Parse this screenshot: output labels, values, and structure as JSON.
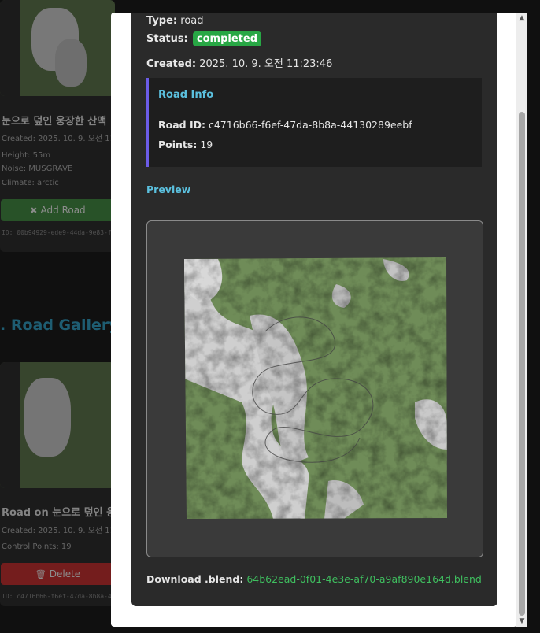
{
  "background": {
    "card1": {
      "title": "눈으로 덮인 웅장한 산맥",
      "created": "Created: 2025. 10. 9. 오전 11:",
      "height": "Height: 55m",
      "noise": "Noise: MUSGRAVE",
      "climate": "Climate: arctic",
      "button_label": "Add Road",
      "id_text": "ID: 00b94929-ede9-44da-9e83-f6c1ef6"
    },
    "section_heading": ". Road Gallery",
    "card2": {
      "title": "Road on 눈으로 덮인 웅",
      "created": "Created: 2025. 10. 9. 오전 11",
      "points": "Control Points: 19",
      "button_label": "Delete",
      "id_text": "ID: c4716b66-f6ef-47da-8b8a-44130289"
    }
  },
  "modal": {
    "type_label": "Type:",
    "type_value": "road",
    "status_label": "Status:",
    "status_value": "completed",
    "created_label": "Created:",
    "created_value": "2025. 10. 9. 오전 11:23:46",
    "road_info": {
      "title": "Road Info",
      "road_id_label": "Road ID:",
      "road_id_value": "c4716b66-f6ef-47da-8b8a-44130289eebf",
      "points_label": "Points:",
      "points_value": "19"
    },
    "preview_label": "Preview",
    "download_label": "Download .blend:",
    "download_file": "64b62ead-0f01-4e3e-af70-a9af890e164d.blend"
  },
  "colors": {
    "accent_blue": "#5bc0de",
    "status_green": "#28a745",
    "link_green": "#3fbf5f",
    "info_border": "#6c5ce7",
    "terrain_green": "#6b8a55",
    "snow": "#d0d0d0"
  },
  "icons": {
    "add_road": "road-icon",
    "delete": "trash-icon",
    "scroll_up": "caret-up-icon",
    "scroll_down": "caret-down-icon"
  }
}
